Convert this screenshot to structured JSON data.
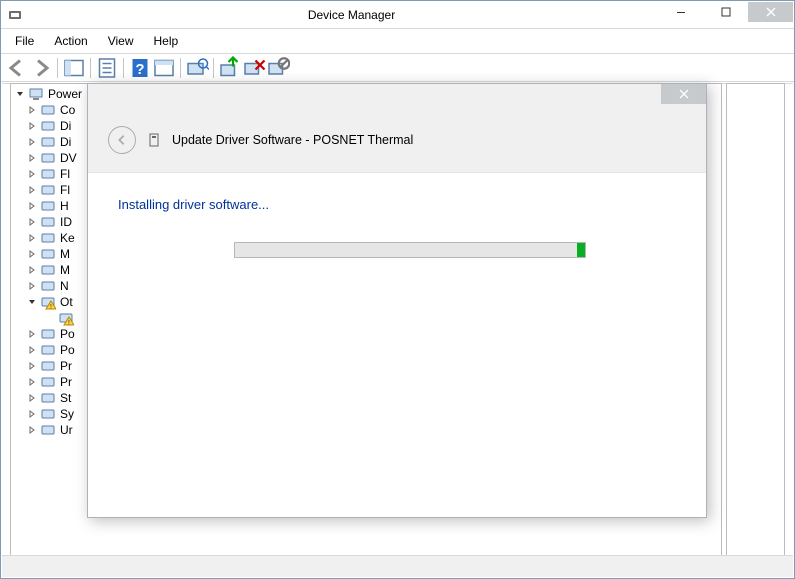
{
  "window": {
    "title": "Device Manager"
  },
  "menubar": [
    "File",
    "Action",
    "View",
    "Help"
  ],
  "tree": {
    "root": "Power",
    "items": [
      {
        "label": "Co",
        "expanded": false
      },
      {
        "label": "Di",
        "expanded": false
      },
      {
        "label": "Di",
        "expanded": false
      },
      {
        "label": "DV",
        "expanded": false
      },
      {
        "label": "Fl",
        "expanded": false
      },
      {
        "label": "Fl",
        "expanded": false
      },
      {
        "label": "H",
        "expanded": false
      },
      {
        "label": "ID",
        "expanded": false
      },
      {
        "label": "Ke",
        "expanded": false
      },
      {
        "label": "M",
        "expanded": false
      },
      {
        "label": "M",
        "expanded": false
      },
      {
        "label": "N",
        "expanded": false
      },
      {
        "label": "Ot",
        "expanded": true,
        "child": ""
      },
      {
        "label": "Po",
        "expanded": false
      },
      {
        "label": "Po",
        "expanded": false
      },
      {
        "label": "Pr",
        "expanded": false
      },
      {
        "label": "Pr",
        "expanded": false
      },
      {
        "label": "St",
        "expanded": false
      },
      {
        "label": "Sy",
        "expanded": false
      },
      {
        "label": "Ur",
        "expanded": false
      }
    ]
  },
  "dialog": {
    "title": "Update Driver Software - POSNET Thermal",
    "status": "Installing driver software..."
  }
}
